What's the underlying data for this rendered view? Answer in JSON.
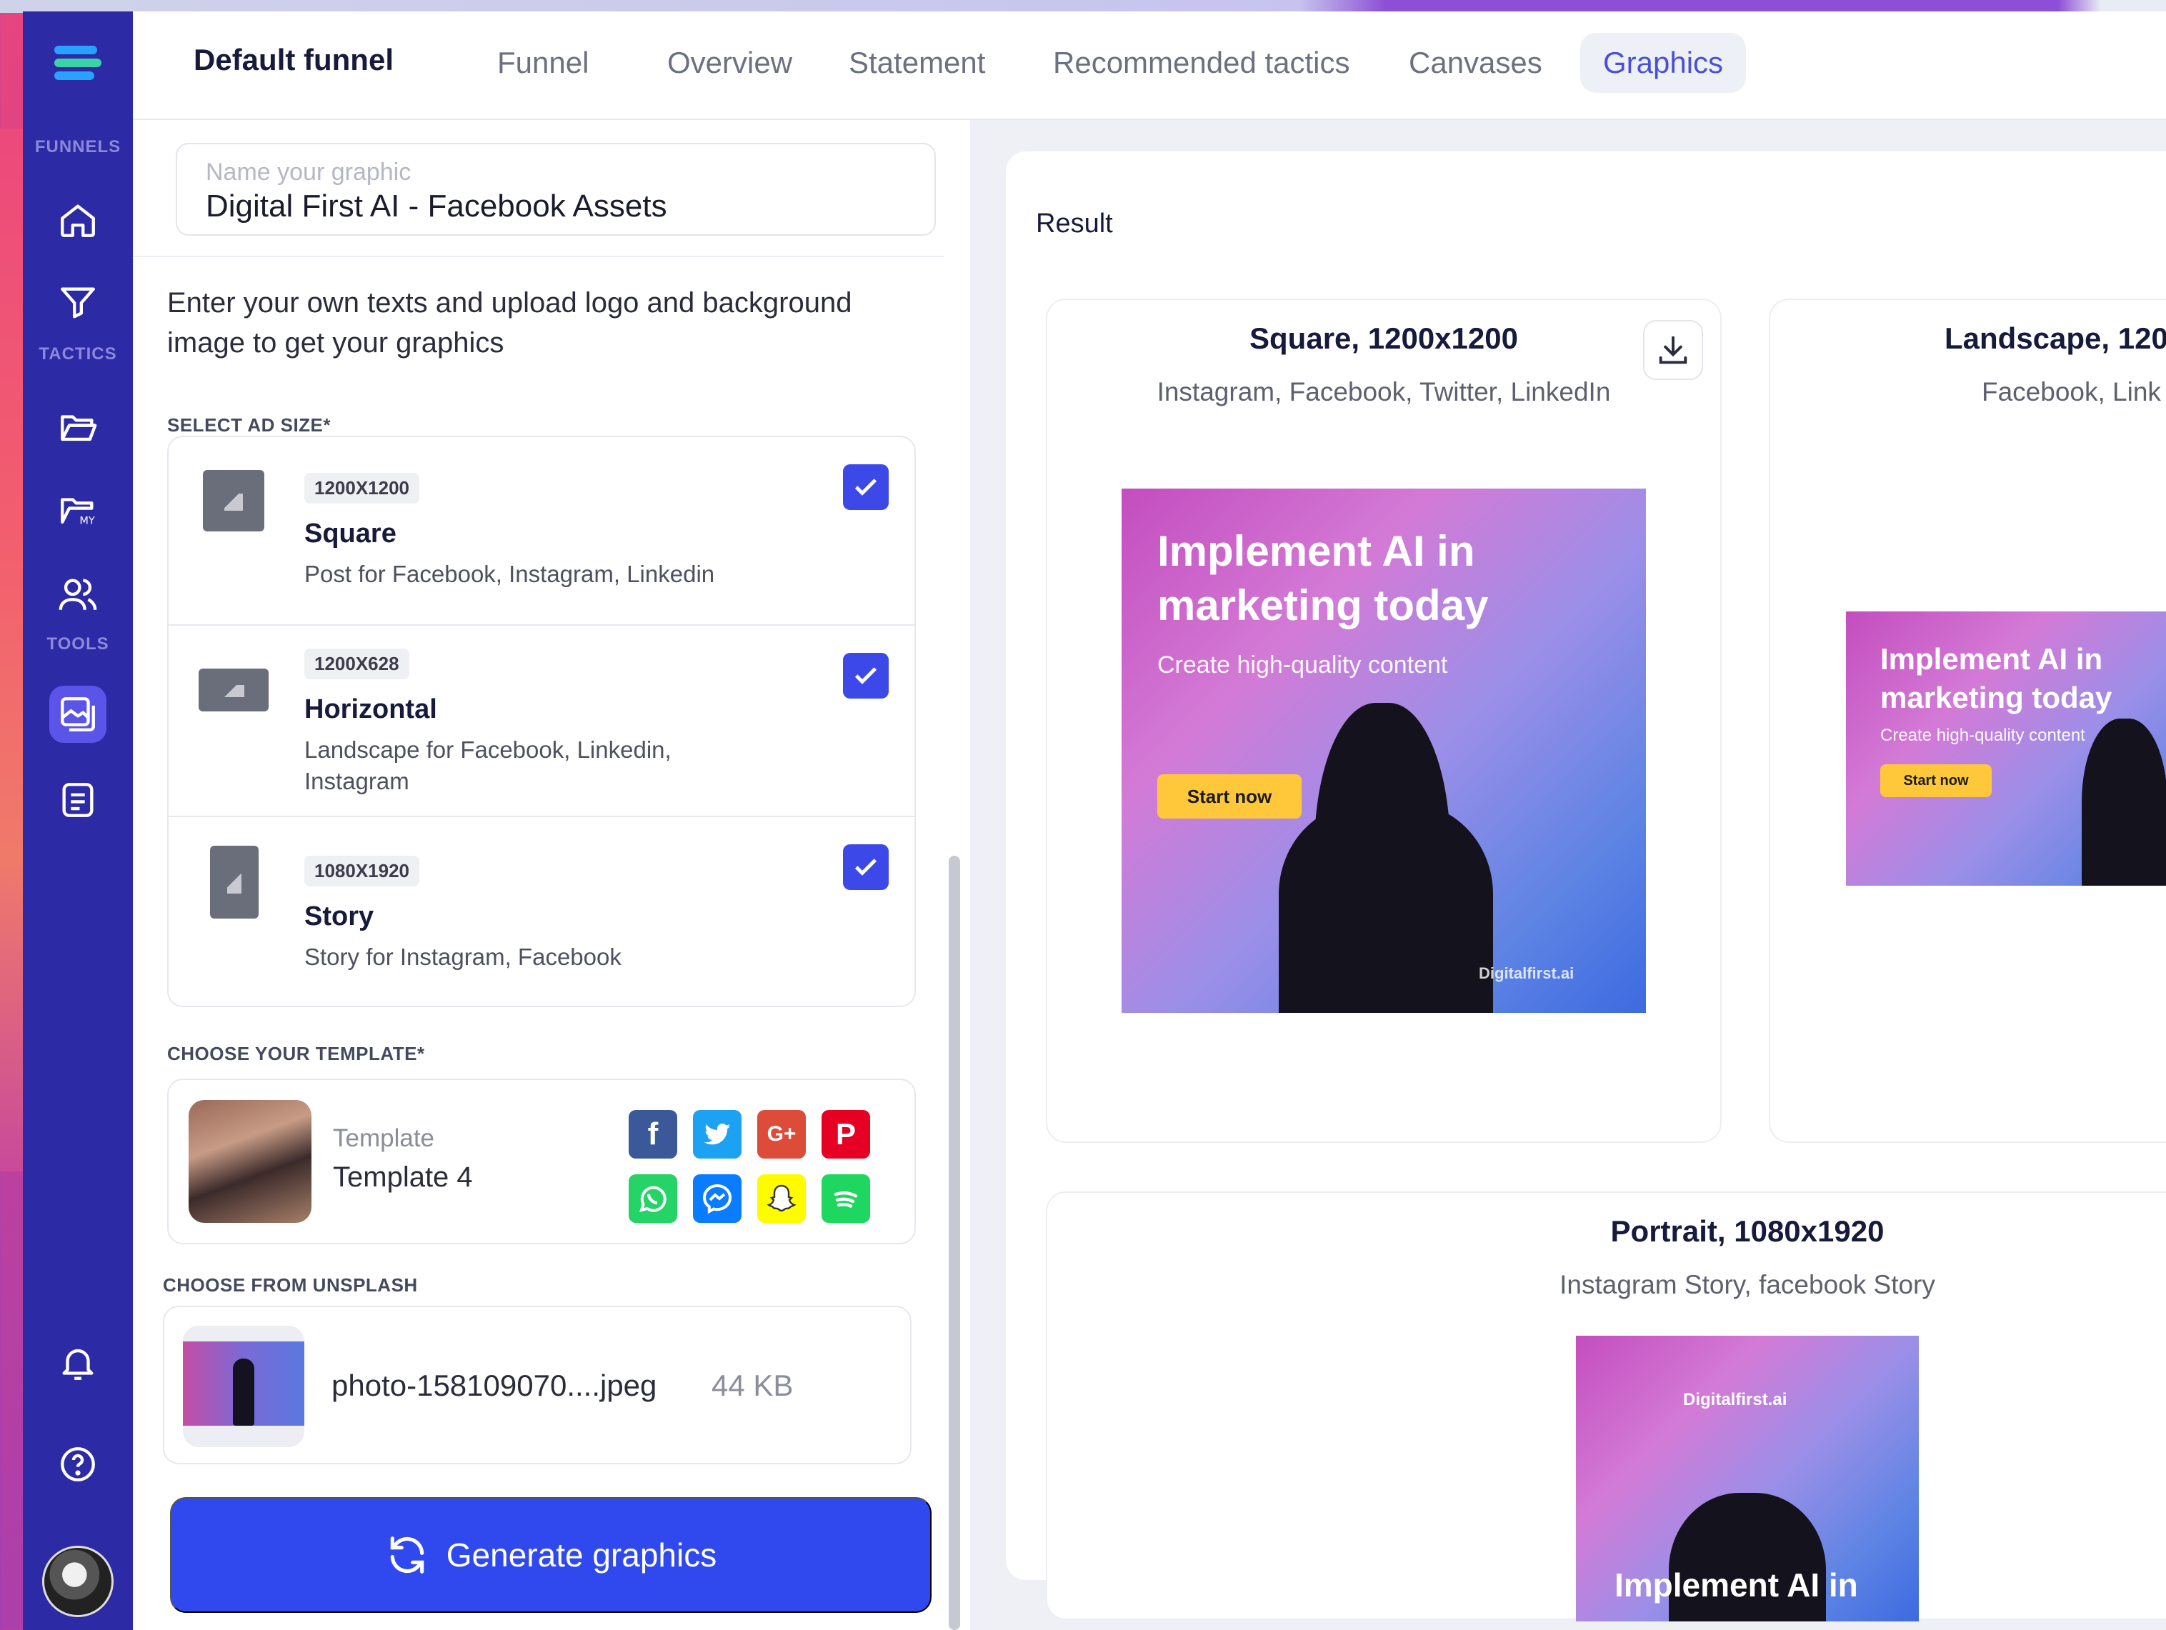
{
  "sidebar": {
    "sections": [
      "FUNNELS",
      "TACTICS",
      "TOOLS"
    ]
  },
  "header": {
    "funnel_title": "Default funnel",
    "tabs": [
      {
        "label": "Funnel"
      },
      {
        "label": "Overview"
      },
      {
        "label": "Statement"
      },
      {
        "label": "Recommended tactics"
      },
      {
        "label": "Canvases"
      },
      {
        "label": "Graphics",
        "active": true
      }
    ]
  },
  "form": {
    "name_placeholder": "Name your graphic",
    "name_value": "Digital First AI - Facebook Assets",
    "intro": "Enter your own texts and upload logo and background image to get your graphics",
    "ad_size_label": "SELECT AD SIZE*",
    "sizes": [
      {
        "dim": "1200X1200",
        "name": "Square",
        "desc": "Post for Facebook, Instagram, Linkedin",
        "checked": true
      },
      {
        "dim": "1200X628",
        "name": "Horizontal",
        "desc": "Landscape for Facebook, Linkedin, Instagram",
        "checked": true
      },
      {
        "dim": "1080X1920",
        "name": "Story",
        "desc": "Story for Instagram, Facebook",
        "checked": true
      }
    ],
    "template_label": "CHOOSE YOUR TEMPLATE*",
    "template": {
      "label": "Template",
      "name": "Template 4"
    },
    "social_icons": [
      {
        "name": "facebook-icon",
        "glyph": "f",
        "color": "#3b5998"
      },
      {
        "name": "twitter-icon",
        "glyph": "t",
        "color": "#1da1f2"
      },
      {
        "name": "google-plus-icon",
        "glyph": "G+",
        "color": "#dd4b39"
      },
      {
        "name": "pinterest-icon",
        "glyph": "P",
        "color": "#e60023"
      },
      {
        "name": "whatsapp-icon",
        "glyph": "W",
        "color": "#25d366"
      },
      {
        "name": "messenger-icon",
        "glyph": "M",
        "color": "#0a7cff"
      },
      {
        "name": "snapchat-icon",
        "glyph": "S",
        "color": "#fffc00"
      },
      {
        "name": "spotify-icon",
        "glyph": "≋",
        "color": "#1ed760"
      }
    ],
    "unsplash_label": "CHOOSE FROM UNSPLASH",
    "photo": {
      "filename": "photo-158109070....jpeg",
      "size": "44 KB"
    },
    "generate_label": "Generate graphics"
  },
  "result": {
    "title": "Result",
    "cards": [
      {
        "title": "Square, 1200x1200",
        "subtitle": "Instagram, Facebook, Twitter, LinkedIn"
      },
      {
        "title": "Landscape, 120",
        "subtitle": "Facebook, Link"
      },
      {
        "title": "Portrait, 1080x1920",
        "subtitle": "Instagram Story, facebook Story"
      }
    ],
    "ad": {
      "headline": "Implement AI in marketing today",
      "sub": "Create high-quality content",
      "button": "Start now",
      "brand_small": "Digitalfirst.ai",
      "brand": "Digitalfirst.ai",
      "portrait_headline": "Implement AI in"
    }
  },
  "colors": {
    "sidebar": "#2d2aa6",
    "accent": "#3d48e8",
    "button": "#2f49ef",
    "ad_cta": "#ffc83b"
  }
}
